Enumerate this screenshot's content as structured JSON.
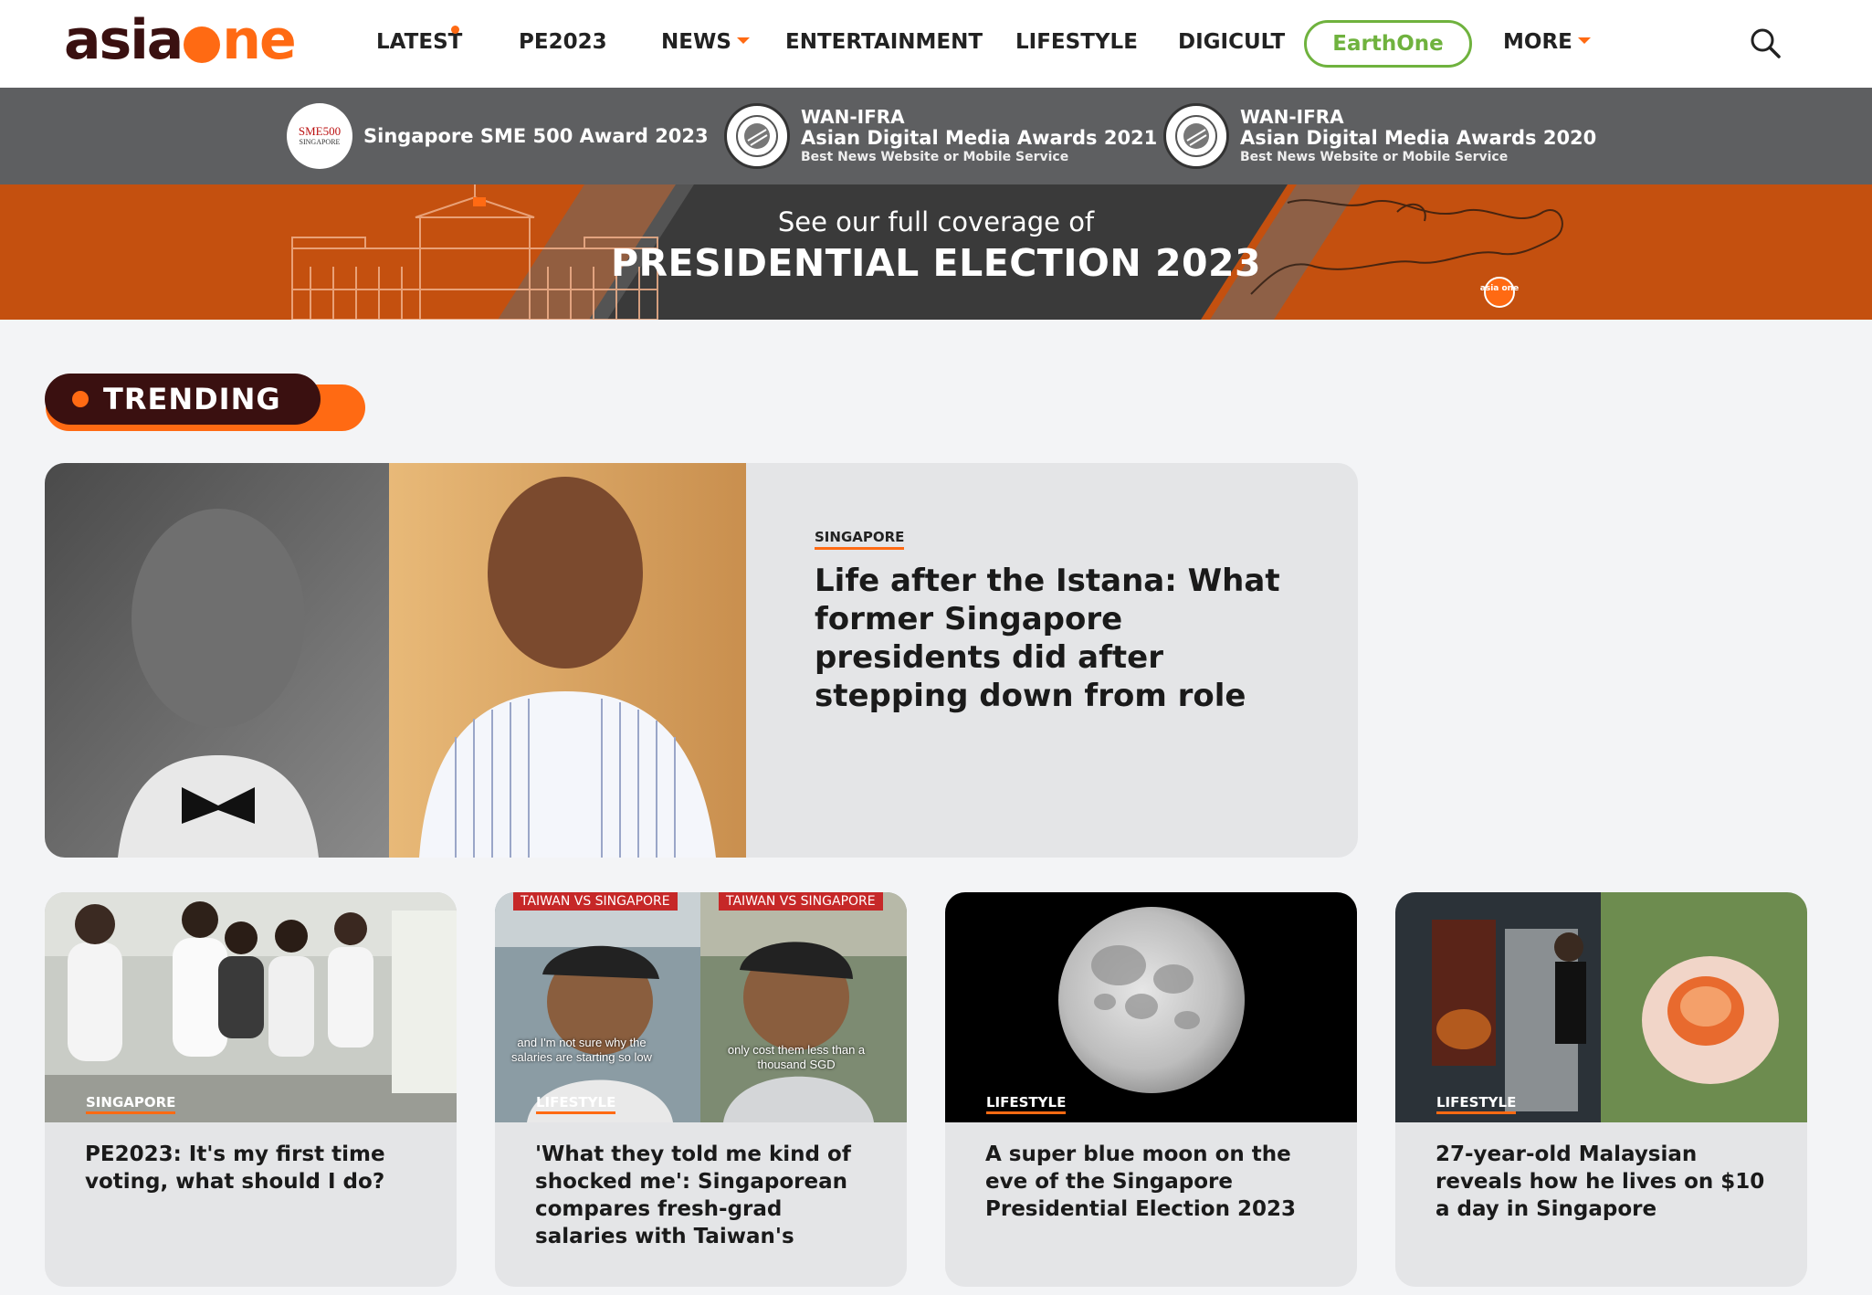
{
  "header": {
    "logo": {
      "part1": "asia",
      "part2": "ne"
    },
    "nav": [
      {
        "label": "LATEST"
      },
      {
        "label": "PE2023"
      },
      {
        "label": "NEWS"
      },
      {
        "label": "ENTERTAINMENT"
      },
      {
        "label": "LIFESTYLE"
      },
      {
        "label": "DIGICULT"
      },
      {
        "label": "EarthOne"
      },
      {
        "label": "MORE"
      }
    ],
    "search_icon": "search-icon"
  },
  "awards": [
    {
      "badge": "SME500",
      "badge_sub": "SINGAPORE",
      "title": "Singapore SME 500 Award 2023"
    },
    {
      "l1": "WAN-IFRA",
      "l2": "Asian Digital Media Awards 2021",
      "l3": "Best News Website or Mobile Service"
    },
    {
      "l1": "WAN-IFRA",
      "l2": "Asian Digital Media Awards 2020",
      "l3": "Best News Website or Mobile Service"
    }
  ],
  "election_banner": {
    "subtitle": "See our full coverage of",
    "title": "PRESIDENTIAL ELECTION 2023",
    "badge": "asia one"
  },
  "trending": {
    "label": "TRENDING"
  },
  "feature": {
    "category": "SINGAPORE",
    "title": "Life after the Istana: What former Singapore presidents did after stepping down from role"
  },
  "cards": [
    {
      "category": "SINGAPORE",
      "title": "PE2023: It's my first time voting, what should I do?"
    },
    {
      "category": "LIFESTYLE",
      "title": "'What they told me kind of shocked me': Singaporean compares fresh-grad salaries with Taiwan's",
      "img_labels": [
        "TAIWAN VS SINGAPORE",
        "TAIWAN VS SINGAPORE"
      ],
      "img_captions": [
        "and I'm not sure why the salaries are starting so low",
        "only cost them less than a thousand SGD"
      ]
    },
    {
      "category": "LIFESTYLE",
      "title": "A super blue moon on the eve of the Singapore Presidential Election 2023"
    },
    {
      "category": "LIFESTYLE",
      "title": "27-year-old Malaysian reveals how he lives on $10 a day in Singapore"
    }
  ],
  "colors": {
    "brand_orange": "#ff6a13",
    "brand_maroon": "#3a1010",
    "earthone_green": "#6fb23e",
    "awards_gray": "#5e5f61"
  }
}
